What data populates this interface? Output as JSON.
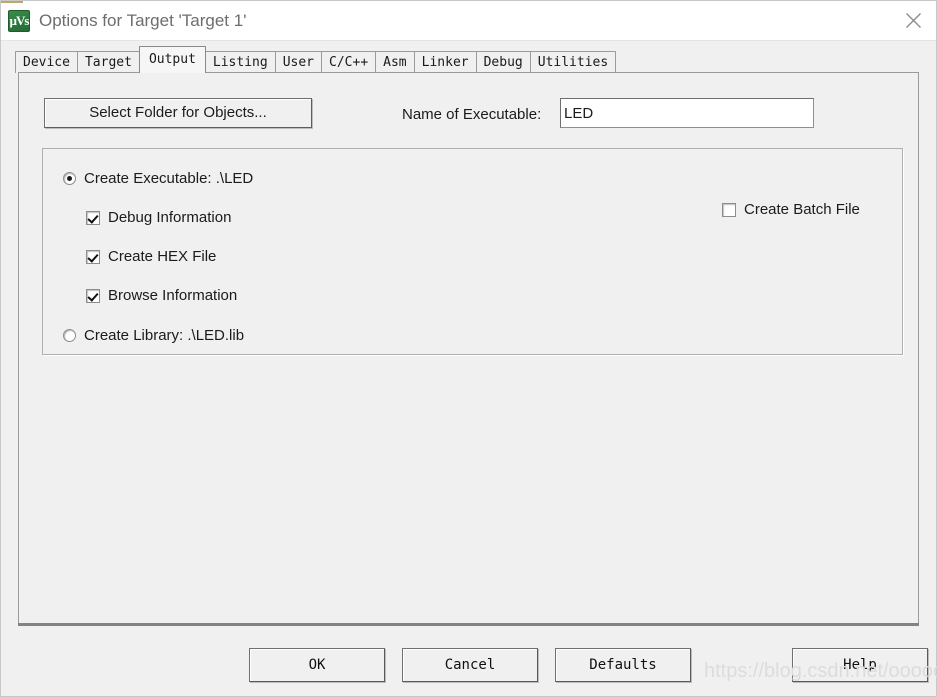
{
  "window": {
    "title": "Options for Target 'Target 1'",
    "icon_name": "keil-uvision-icon",
    "icon_glyph": "µVs",
    "close_icon": "close-icon"
  },
  "tabs": [
    {
      "label": "Device",
      "active": false
    },
    {
      "label": "Target",
      "active": false
    },
    {
      "label": "Output",
      "active": true
    },
    {
      "label": "Listing",
      "active": false
    },
    {
      "label": "User",
      "active": false
    },
    {
      "label": "C/C++",
      "active": false
    },
    {
      "label": "Asm",
      "active": false
    },
    {
      "label": "Linker",
      "active": false
    },
    {
      "label": "Debug",
      "active": false
    },
    {
      "label": "Utilities",
      "active": false
    }
  ],
  "output": {
    "select_folder_button": "Select Folder for Objects...",
    "executable_label": "Name of Executable:",
    "executable_value": "LED",
    "create_executable": {
      "label": "Create Executable:  .\\LED",
      "checked": true
    },
    "debug_information": {
      "label": "Debug Information",
      "checked": true
    },
    "create_hex_file": {
      "label": "Create HEX File",
      "checked": true
    },
    "browse_information": {
      "label": "Browse Information",
      "checked": true
    },
    "create_library": {
      "label": "Create Library:  .\\LED.lib",
      "checked": false
    },
    "create_batch_file": {
      "label": "Create Batch File",
      "checked": false
    }
  },
  "footer": {
    "ok": "OK",
    "cancel": "Cancel",
    "defaults": "Defaults",
    "help": "Help"
  },
  "watermark": "https://blog.csdn.net/oooooohou",
  "colors": {
    "background": "#f0f0f0",
    "titlebar": "#ffffff",
    "icon_green": "#2c7a3e",
    "text": "#1b1b1b",
    "title_text": "#6d6d6d",
    "border": "#9b9b9b"
  }
}
